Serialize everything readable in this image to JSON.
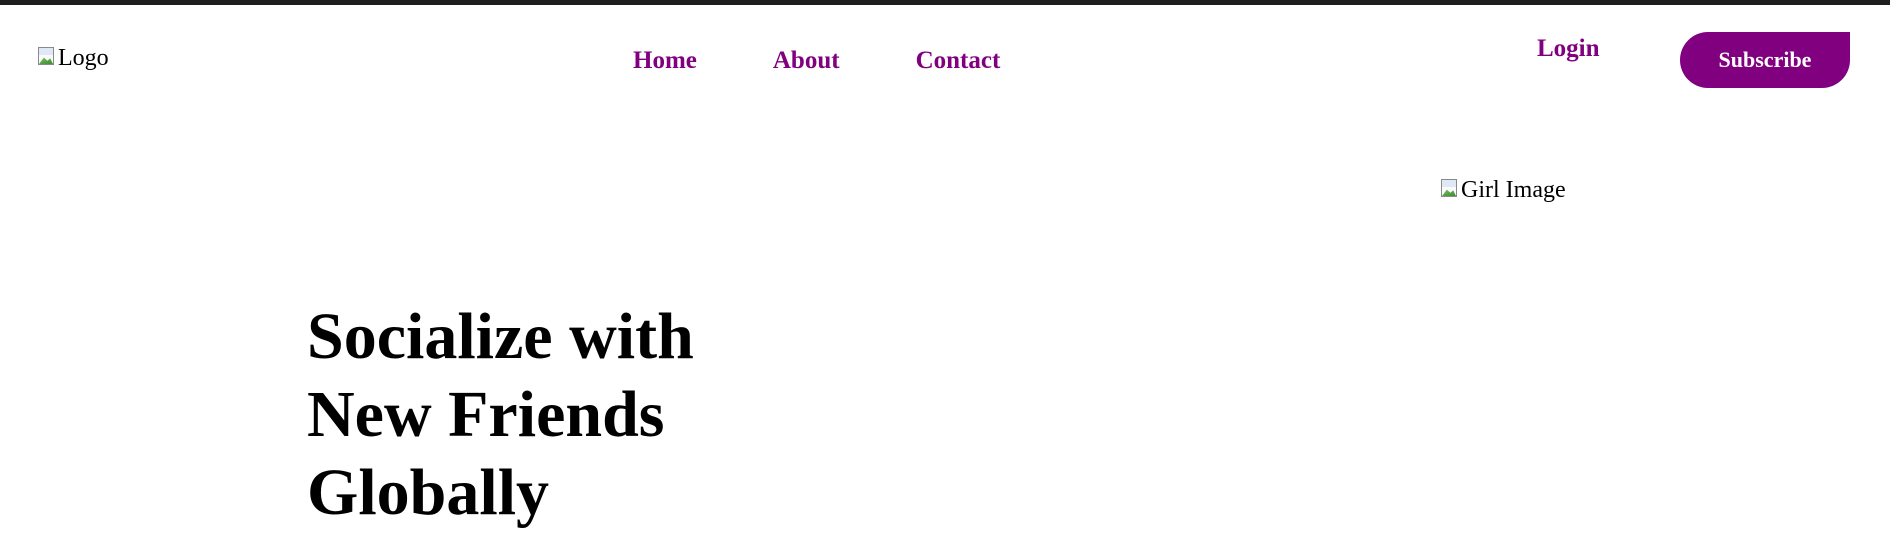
{
  "header": {
    "logo_alt": "Logo",
    "nav": {
      "home": "Home",
      "about": "About",
      "contact": "Contact"
    },
    "login_label": "Login",
    "subscribe_label": "Subscribe"
  },
  "hero": {
    "image_alt": "Girl Image",
    "headline_lines": [
      "Socialize with",
      "New Friends",
      "Globally"
    ]
  },
  "colors": {
    "accent": "#800080",
    "topbar": "#1e1e1e",
    "text": "#000000",
    "background": "#ffffff"
  }
}
